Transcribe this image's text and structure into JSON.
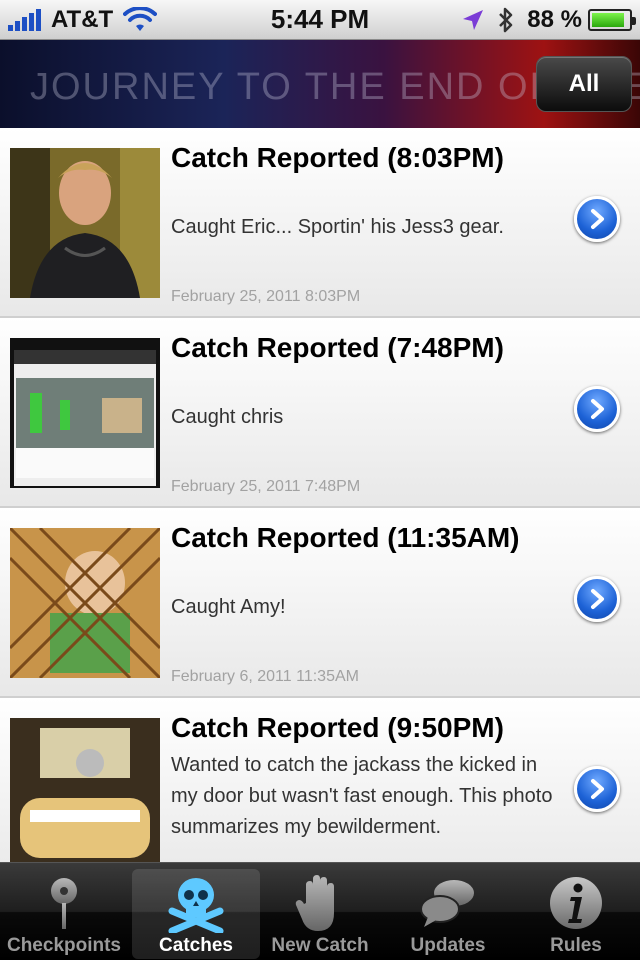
{
  "status_bar": {
    "carrier": "AT&T",
    "time": "5:44 PM",
    "battery_text": "88 %",
    "battery_level": 0.88
  },
  "header": {
    "title": "JOURNEY TO THE END OF THE N",
    "all_button": "All"
  },
  "catches": [
    {
      "title": "Catch Reported (8:03PM)",
      "description": "Caught Eric... Sportin' his Jess3 gear.",
      "date": "February 25, 2011 8:03PM"
    },
    {
      "title": "Catch Reported (7:48PM)",
      "description": "Caught chris",
      "date": "February 25, 2011 7:48PM"
    },
    {
      "title": "Catch Reported (11:35AM)",
      "description": "Caught Amy!",
      "date": "February 6, 2011 11:35AM"
    },
    {
      "title": "Catch Reported (9:50PM)",
      "description": "Wanted to catch the jackass the kicked in my door but wasn't fast enough. This photo summarizes my bewilderment.",
      "date": ""
    }
  ],
  "tabs": [
    {
      "label": "Checkpoints",
      "icon": "map-pin-icon",
      "active": false
    },
    {
      "label": "Catches",
      "icon": "skull-crossbones-icon",
      "active": true
    },
    {
      "label": "New Catch",
      "icon": "hand-icon",
      "active": false
    },
    {
      "label": "Updates",
      "icon": "speech-bubbles-icon",
      "active": false
    },
    {
      "label": "Rules",
      "icon": "info-icon",
      "active": false
    }
  ],
  "colors": {
    "accent": "#1d62d6",
    "active_tab_icon": "#5ec9ff"
  }
}
